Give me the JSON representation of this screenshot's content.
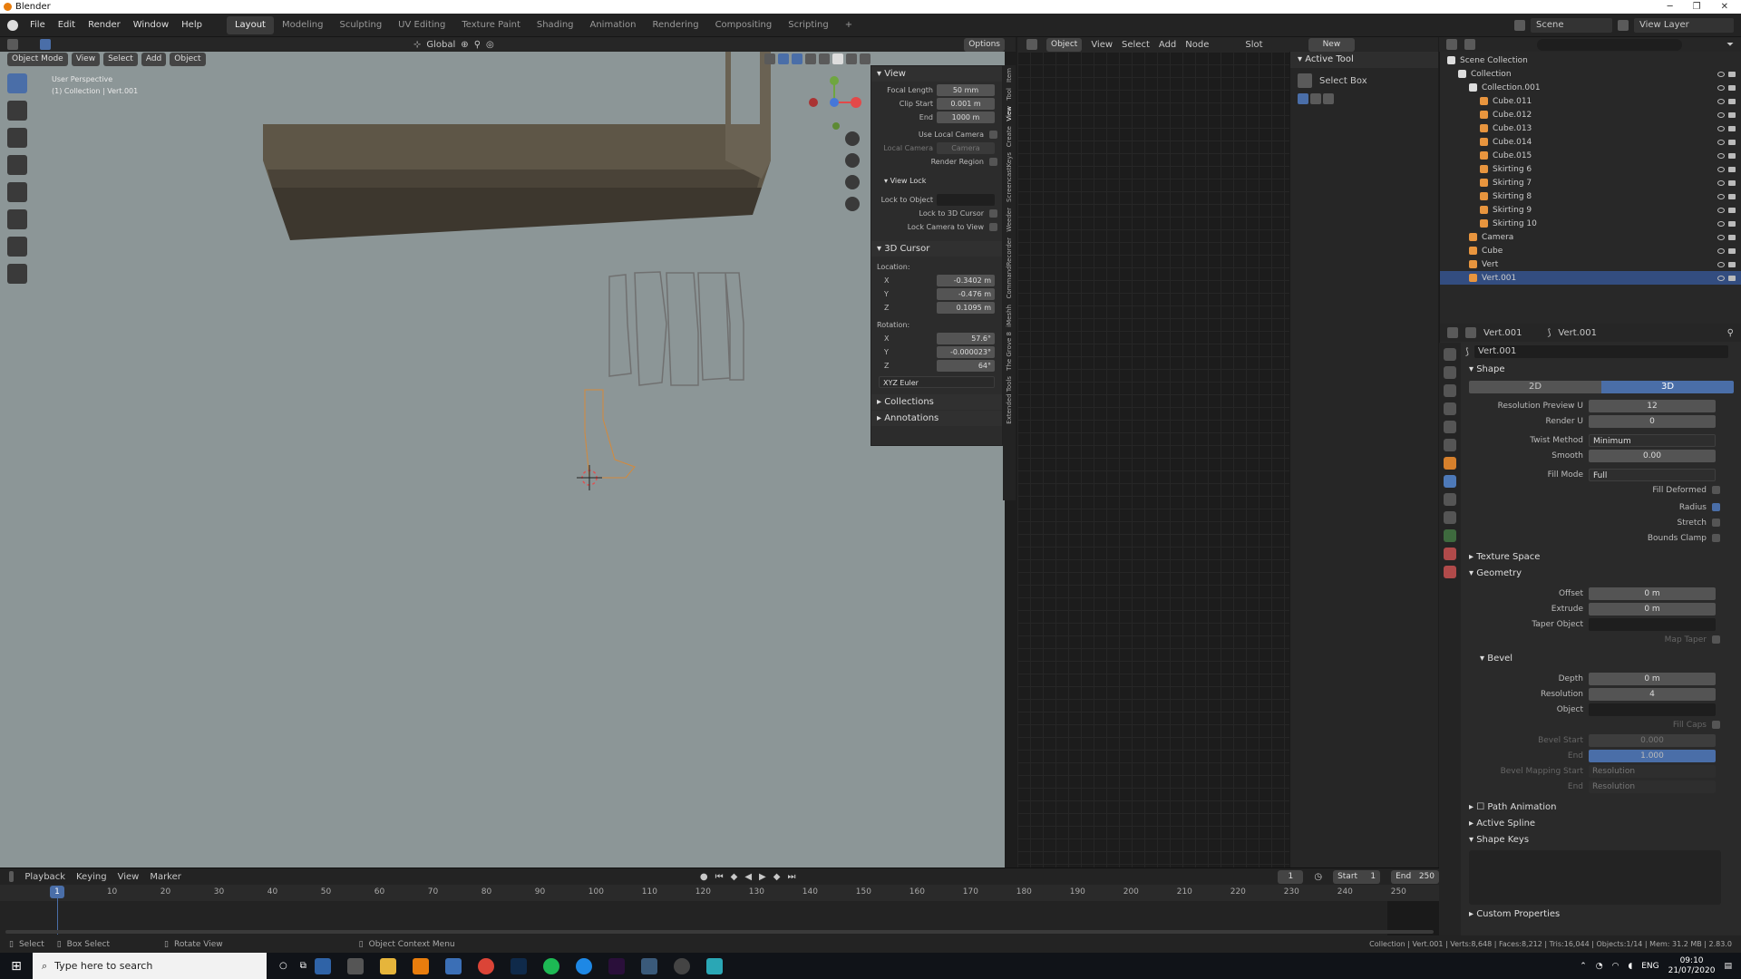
{
  "titlebar": {
    "title": "Blender"
  },
  "menu": [
    "File",
    "Edit",
    "Render",
    "Window",
    "Help"
  ],
  "workspaces": [
    "Layout",
    "Modeling",
    "Sculpting",
    "UV Editing",
    "Texture Paint",
    "Shading",
    "Animation",
    "Rendering",
    "Compositing",
    "Scripting"
  ],
  "header3d": {
    "mode": "Object Mode",
    "items": [
      "View",
      "Select",
      "Add",
      "Object"
    ],
    "transform": "Global",
    "options": "Options"
  },
  "viewport": {
    "perspective": "User Perspective",
    "collection": "(1) Collection | Vert.001"
  },
  "npanel": {
    "view_title": "View",
    "focal_length_label": "Focal Length",
    "focal_length": "50 mm",
    "clip_start_label": "Clip Start",
    "clip_start": "0.001 m",
    "end_label": "End",
    "end": "1000 m",
    "use_local_camera": "Use Local Camera",
    "local_camera_label": "Local Camera",
    "local_camera": "Camera",
    "render_region": "Render Region",
    "view_lock": "View Lock",
    "lock_to_object": "Lock to Object",
    "lock_to_3d_cursor": "Lock to 3D Cursor",
    "lock_camera_to_view": "Lock Camera to View",
    "cursor_title": "3D Cursor",
    "location_label": "Location:",
    "loc_x": "-0.3402 m",
    "loc_y": "-0.476 m",
    "loc_z": "0.1095 m",
    "rotation_label": "Rotation:",
    "rot_x": "57.6°",
    "rot_y": "-0.000023°",
    "rot_z": "64°",
    "rot_mode": "XYZ Euler",
    "collections": "Collections",
    "annotations": "Annotations",
    "tabs": [
      "Item",
      "Tool",
      "View",
      "Create",
      "ScreencastKeys",
      "Weeder",
      "CommandRecorder",
      "iMeshh",
      "The Grove 8",
      "Extended Tools"
    ]
  },
  "nodeeditor": {
    "object": "Object",
    "items": [
      "View",
      "Select",
      "Add",
      "Node"
    ],
    "slot": "Slot",
    "new": "New"
  },
  "activetool": {
    "title": "Active Tool",
    "tool": "Select Box"
  },
  "outliner": {
    "scene": "Scene",
    "viewlayer": "View Layer",
    "rows": [
      {
        "label": "Scene Collection",
        "indent": 0
      },
      {
        "label": "Collection",
        "indent": 1
      },
      {
        "label": "Collection.001",
        "indent": 2
      },
      {
        "label": "Cube.011",
        "indent": 3
      },
      {
        "label": "Cube.012",
        "indent": 3
      },
      {
        "label": "Cube.013",
        "indent": 3
      },
      {
        "label": "Cube.014",
        "indent": 3
      },
      {
        "label": "Cube.015",
        "indent": 3
      },
      {
        "label": "Skirting 6",
        "indent": 3
      },
      {
        "label": "Skirting 7",
        "indent": 3
      },
      {
        "label": "Skirting 8",
        "indent": 3
      },
      {
        "label": "Skirting 9",
        "indent": 3
      },
      {
        "label": "Skirting 10",
        "indent": 3
      },
      {
        "label": "Camera",
        "indent": 2
      },
      {
        "label": "Cube",
        "indent": 2
      },
      {
        "label": "Vert",
        "indent": 2
      },
      {
        "label": "Vert.001",
        "indent": 2
      }
    ]
  },
  "props": {
    "obj": "Vert.001",
    "data": "Vert.001",
    "datablock": "Vert.001",
    "shape": "Shape",
    "d2": "2D",
    "d3": "3D",
    "res_preview_u_label": "Resolution Preview U",
    "res_preview_u": "12",
    "render_u_label": "Render U",
    "render_u": "0",
    "twist_method_label": "Twist Method",
    "twist_method": "Minimum",
    "smooth_label": "Smooth",
    "smooth": "0.00",
    "fill_mode_label": "Fill Mode",
    "fill_mode": "Full",
    "fill_deformed": "Fill Deformed",
    "radius": "Radius",
    "stretch": "Stretch",
    "bounds_clamp": "Bounds Clamp",
    "texture_space": "Texture Space",
    "geometry": "Geometry",
    "offset_label": "Offset",
    "offset": "0 m",
    "extrude_label": "Extrude",
    "extrude": "0 m",
    "taper_label": "Taper Object",
    "map_taper": "Map Taper",
    "bevel": "Bevel",
    "depth_label": "Depth",
    "depth": "0 m",
    "resolution_label": "Resolution",
    "resolution": "4",
    "object_label": "Object",
    "fill_caps": "Fill Caps",
    "bevel_start_label": "Bevel Start",
    "bevel_start": "0.000",
    "bevel_end_label": "End",
    "bevel_end": "1.000",
    "bevel_map_start_label": "Bevel Mapping Start",
    "bevel_map_start": "Resolution",
    "bevel_map_end_label": "End",
    "bevel_map_end": "Resolution",
    "path_animation": "Path Animation",
    "active_spline": "Active Spline",
    "shape_keys": "Shape Keys",
    "custom_props": "Custom Properties"
  },
  "timeline": {
    "items": [
      "Playback",
      "Keying",
      "View",
      "Marker"
    ],
    "frame": "1",
    "start_label": "Start",
    "start": "1",
    "end_label": "End",
    "end": "250",
    "ticks": [
      "1",
      "10",
      "20",
      "30",
      "40",
      "50",
      "60",
      "70",
      "80",
      "90",
      "100",
      "110",
      "120",
      "130",
      "140",
      "150",
      "160",
      "170",
      "180",
      "190",
      "200",
      "210",
      "220",
      "230",
      "240",
      "250"
    ]
  },
  "status": {
    "select": "Select",
    "box_select": "Box Select",
    "rotate_view": "Rotate View",
    "context_menu": "Object Context Menu",
    "stats": "Collection | Vert.001 | Verts:8,648 | Faces:8,212 | Tris:16,044 | Objects:1/14 | Mem: 31.2 MB | 2.83.0"
  },
  "taskbar": {
    "search": "Type here to search",
    "lang": "ENG",
    "time": "09:10",
    "date": "21/07/2020"
  }
}
